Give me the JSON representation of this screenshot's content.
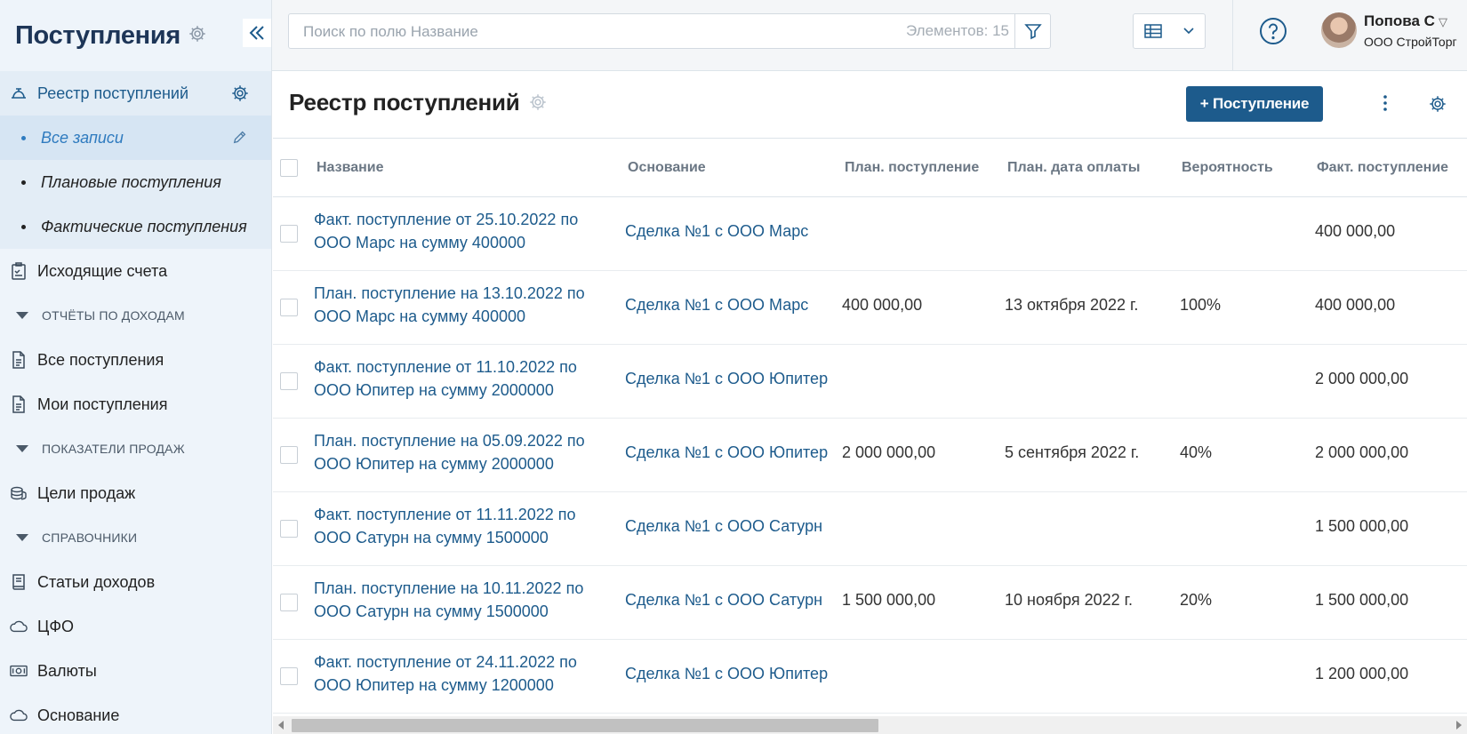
{
  "app": {
    "title": "Поступления"
  },
  "sidebar": {
    "registry": "Реестр поступлений",
    "subs": [
      "Все записи",
      "Плановые поступления",
      "Фактические поступления"
    ],
    "outgoing": "Исходящие счета",
    "section_income": "ОТЧЁТЫ ПО ДОХОДАМ",
    "all_income": "Все поступления",
    "my_income": "Мои поступления",
    "section_sales": "ПОКАЗАТЕЛИ ПРОДАЖ",
    "sales_goals": "Цели продаж",
    "section_refs": "СПРАВОЧНИКИ",
    "income_items": "Статьи доходов",
    "cfo": "ЦФО",
    "currencies": "Валюты",
    "basis": "Основание"
  },
  "topbar": {
    "search_placeholder": "Поиск по полю Название",
    "count": "Элементов: 15",
    "user_name": "Попова С",
    "user_company": "ООО СтройТорг"
  },
  "main": {
    "title": "Реестр поступлений",
    "add_button": "+ Поступление"
  },
  "table": {
    "headers": [
      "Название",
      "Основание",
      "План. поступление",
      "План. дата оплаты",
      "Вероятность",
      "Факт. поступление"
    ],
    "rows": [
      {
        "name": "Факт. поступление от 25.10.2022 по ООО Марс на сумму 400000",
        "base": "Сделка №1 с ООО Марс",
        "plan": "",
        "date": "",
        "prob": "",
        "fact": "400 000,00"
      },
      {
        "name": "План. поступление на 13.10.2022 по ООО Марс на сумму 400000",
        "base": "Сделка №1 с ООО Марс",
        "plan": "400 000,00",
        "date": "13 октября 2022 г.",
        "prob": "100%",
        "fact": "400 000,00"
      },
      {
        "name": "Факт. поступление от 11.10.2022 по ООО Юпитер на сумму 2000000",
        "base": "Сделка №1 с ООО Юпитер",
        "plan": "",
        "date": "",
        "prob": "",
        "fact": "2 000 000,00"
      },
      {
        "name": "План. поступление на 05.09.2022 по ООО Юпитер на сумму 2000000",
        "base": "Сделка №1 с ООО Юпитер",
        "plan": "2 000 000,00",
        "date": "5 сентября 2022 г.",
        "prob": "40%",
        "fact": "2 000 000,00"
      },
      {
        "name": "Факт. поступление от 11.11.2022 по ООО Сатурн на сумму 1500000",
        "base": "Сделка №1 с ООО Сатурн",
        "plan": "",
        "date": "",
        "prob": "",
        "fact": "1 500 000,00"
      },
      {
        "name": "План. поступление на 10.11.2022 по ООО Сатурн на сумму 1500000",
        "base": "Сделка №1 с ООО Сатурн",
        "plan": "1 500 000,00",
        "date": "10 ноября 2022 г.",
        "prob": "20%",
        "fact": "1 500 000,00"
      },
      {
        "name": "Факт. поступление от 24.11.2022 по ООО Юпитер на сумму 1200000",
        "base": "Сделка №1 с ООО Юпитер",
        "plan": "",
        "date": "",
        "prob": "",
        "fact": "1 200 000,00"
      }
    ]
  },
  "colors": {
    "accent": "#1d5b8c",
    "link": "#1d5b8c",
    "sidebar_bg": "#eef4fa",
    "selected": "#2f7bbf"
  }
}
